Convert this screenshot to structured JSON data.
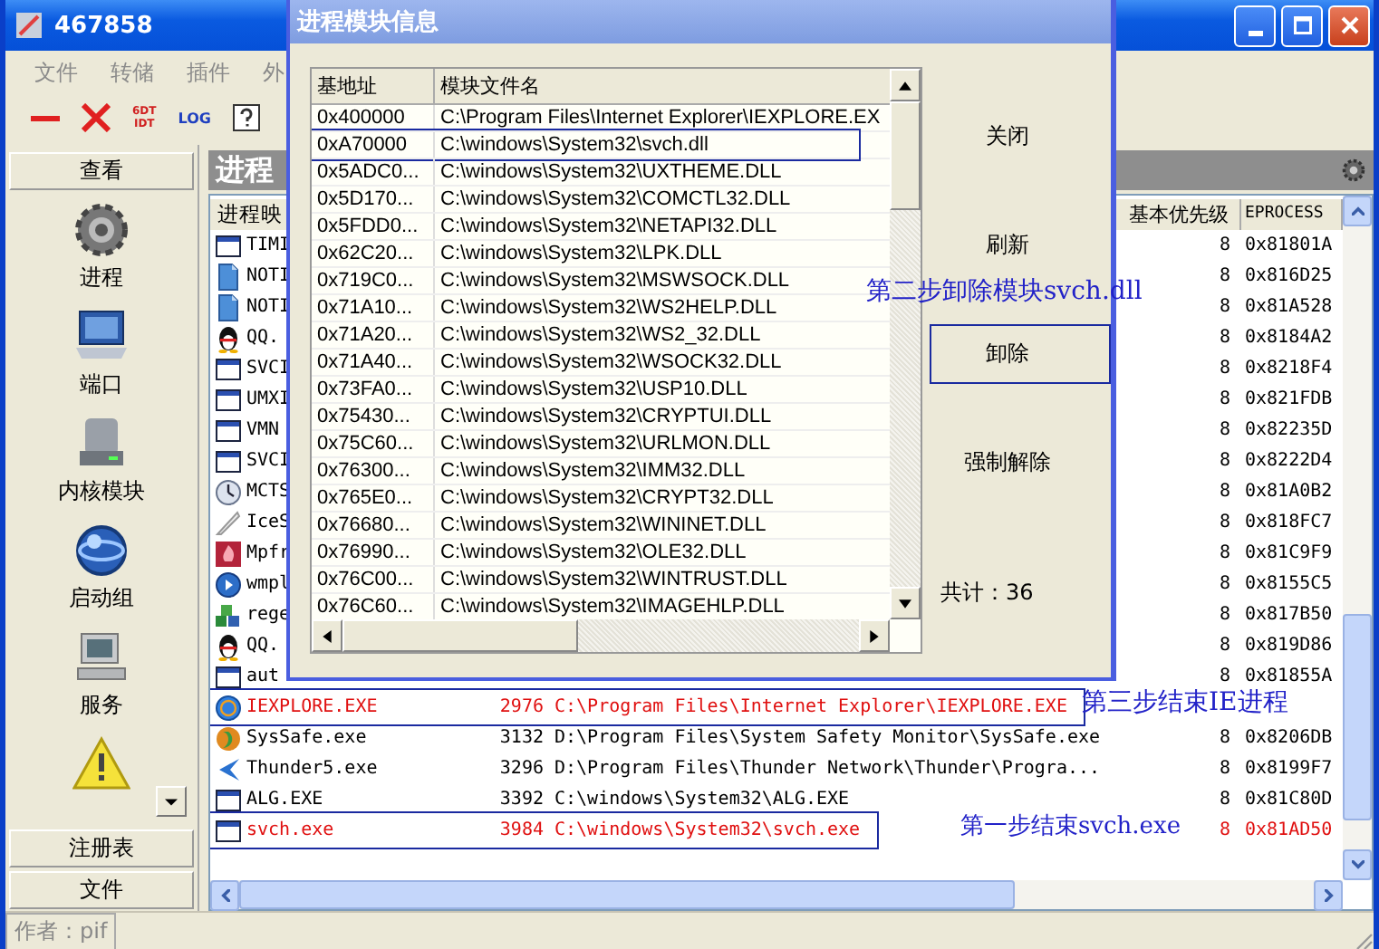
{
  "window": {
    "title": "467858"
  },
  "menu": [
    "文件",
    "转储",
    "插件",
    "外"
  ],
  "toolbar": [
    {
      "kind": "minus"
    },
    {
      "kind": "cross"
    },
    {
      "kind": "stack",
      "text": "6DT",
      "text2": "IDT"
    },
    {
      "kind": "text",
      "text": "LOG"
    },
    {
      "kind": "help"
    }
  ],
  "sidebar": {
    "header": "查看",
    "items": [
      {
        "label": "进程"
      },
      {
        "label": "端口"
      },
      {
        "label": "内核模块"
      },
      {
        "label": "启动组"
      },
      {
        "label": "服务"
      }
    ],
    "tabs": [
      "注册表",
      "文件"
    ]
  },
  "panel": {
    "title": "进程",
    "columns": {
      "column_1": "进程映",
      "column_4": "基本优先级",
      "column_5": "EPROCESS"
    },
    "processes": [
      {
        "name": "TIMI",
        "priority": "8",
        "eprocess": "0x81801A"
      },
      {
        "name": "NOTI",
        "priority": "8",
        "eprocess": "0x816D25"
      },
      {
        "name": "NOTI",
        "priority": "8",
        "eprocess": "0x81A528"
      },
      {
        "name": "QQ.",
        "priority": "8",
        "eprocess": "0x8184A2"
      },
      {
        "name": "SVCI",
        "priority": "8",
        "eprocess": "0x8218F4"
      },
      {
        "name": "UMXI",
        "priority": "8",
        "eprocess": "0x821FDB"
      },
      {
        "name": "VMN",
        "priority": "8",
        "eprocess": "0x82235D"
      },
      {
        "name": "SVCI",
        "priority": "8",
        "eprocess": "0x8222D4"
      },
      {
        "name": "MCTS",
        "priority": "8",
        "eprocess": "0x81A0B2"
      },
      {
        "name": "IceS",
        "priority": "8",
        "eprocess": "0x818FC7"
      },
      {
        "name": "Mpfr",
        "priority": "8",
        "eprocess": "0x81C9F9"
      },
      {
        "name": "wmpl",
        "priority": "8",
        "eprocess": "0x8155C5"
      },
      {
        "name": "rege",
        "priority": "8",
        "eprocess": "0x817B50"
      },
      {
        "name": "QQ.",
        "priority": "8",
        "eprocess": "0x819D86"
      },
      {
        "name": "aut",
        "priority": "8",
        "eprocess": "0x81855A"
      },
      {
        "name": "IEXPLORE.EXE",
        "pid": "2976",
        "path": "C:\\Program Files\\Internet Explorer\\IEXPLORE.EXE",
        "flagged": true,
        "highlighted": true
      },
      {
        "name": "SysSafe.exe",
        "pid": "3132",
        "path": "D:\\Program Files\\System Safety Monitor\\SysSafe.exe",
        "priority": "8",
        "eprocess": "0x8206DB",
        "flagged": false,
        "highlighted": false
      },
      {
        "name": "Thunder5.exe",
        "pid": "3296",
        "path": "D:\\Program Files\\Thunder Network\\Thunder\\Progra...",
        "priority": "8",
        "eprocess": "0x8199F7",
        "flagged": false,
        "highlighted": false
      },
      {
        "name": "ALG.EXE",
        "pid": "3392",
        "path": "C:\\windows\\System32\\ALG.EXE",
        "priority": "8",
        "eprocess": "0x81C80D",
        "flagged": false,
        "highlighted": false
      },
      {
        "name": "svch.exe",
        "pid": "3984",
        "path": "C:\\windows\\System32\\svch.exe",
        "priority": "8",
        "eprocess": "0x81AD50",
        "flagged": true,
        "highlighted": true
      }
    ]
  },
  "status_bar": "作者：pif",
  "dialog": {
    "title": "进程模块信息",
    "columns": [
      "基地址",
      "模块文件名"
    ],
    "modules": [
      {
        "base": "0x400000",
        "file": "C:\\Program Files\\Internet Explorer\\IEXPLORE.EX",
        "highlighted": false
      },
      {
        "base": "0xA70000",
        "file": "C:\\windows\\System32\\svch.dll",
        "highlighted": true
      },
      {
        "base": "0x5ADC0...",
        "file": "C:\\windows\\System32\\UXTHEME.DLL",
        "highlighted": false
      },
      {
        "base": "0x5D170...",
        "file": "C:\\windows\\System32\\COMCTL32.DLL",
        "highlighted": false
      },
      {
        "base": "0x5FDD0...",
        "file": "C:\\windows\\System32\\NETAPI32.DLL",
        "highlighted": false
      },
      {
        "base": "0x62C20...",
        "file": "C:\\windows\\System32\\LPK.DLL",
        "highlighted": false
      },
      {
        "base": "0x719C0...",
        "file": "C:\\windows\\System32\\MSWSOCK.DLL",
        "highlighted": false
      },
      {
        "base": "0x71A10...",
        "file": "C:\\windows\\System32\\WS2HELP.DLL",
        "highlighted": false
      },
      {
        "base": "0x71A20...",
        "file": "C:\\windows\\System32\\WS2_32.DLL",
        "highlighted": false
      },
      {
        "base": "0x71A40...",
        "file": "C:\\windows\\System32\\WSOCK32.DLL",
        "highlighted": false
      },
      {
        "base": "0x73FA0...",
        "file": "C:\\windows\\System32\\USP10.DLL",
        "highlighted": false
      },
      {
        "base": "0x75430...",
        "file": "C:\\windows\\System32\\CRYPTUI.DLL",
        "highlighted": false
      },
      {
        "base": "0x75C60...",
        "file": "C:\\windows\\System32\\URLMON.DLL",
        "highlighted": false
      },
      {
        "base": "0x76300...",
        "file": "C:\\windows\\System32\\IMM32.DLL",
        "highlighted": false
      },
      {
        "base": "0x765E0...",
        "file": "C:\\windows\\System32\\CRYPT32.DLL",
        "highlighted": false
      },
      {
        "base": "0x76680...",
        "file": "C:\\windows\\System32\\WININET.DLL",
        "highlighted": false
      },
      {
        "base": "0x76990...",
        "file": "C:\\windows\\System32\\OLE32.DLL",
        "highlighted": false
      },
      {
        "base": "0x76C00...",
        "file": "C:\\windows\\System32\\WINTRUST.DLL",
        "highlighted": false
      },
      {
        "base": "0x76C60...",
        "file": "C:\\windows\\System32\\IMAGEHLP.DLL",
        "highlighted": false
      }
    ],
    "buttons": [
      {
        "label": "关闭",
        "highlighted": false
      },
      {
        "label": "刷新",
        "highlighted": false
      },
      {
        "label": "卸除",
        "highlighted": true
      },
      {
        "label": "强制解除",
        "highlighted": false
      }
    ],
    "total": "共计：36"
  },
  "annotations": [
    {
      "text": "第二步卸除模块svch.dll"
    },
    {
      "text": "第三步结束IE进程"
    },
    {
      "text": "第一步结束svch.exe"
    }
  ]
}
